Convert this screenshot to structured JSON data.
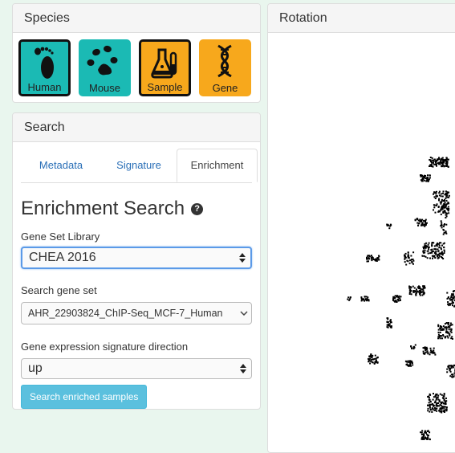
{
  "species_panel": {
    "title": "Species",
    "buttons": [
      {
        "label": "Human",
        "icon": "footprint-icon",
        "color": "#1bbab4",
        "selected": true
      },
      {
        "label": "Mouse",
        "icon": "paw-icon",
        "color": "#1bbab4",
        "selected": false
      },
      {
        "label": "Sample",
        "icon": "flask-icon",
        "color": "#f7a81c",
        "selected": true
      },
      {
        "label": "Gene",
        "icon": "dna-icon",
        "color": "#f7a81c",
        "selected": false
      }
    ]
  },
  "search_panel": {
    "title": "Search",
    "tabs": [
      {
        "label": "Metadata",
        "active": false
      },
      {
        "label": "Signature",
        "active": false
      },
      {
        "label": "Enrichment",
        "active": true
      }
    ],
    "form": {
      "heading": "Enrichment Search",
      "library_label": "Gene Set Library",
      "library_value": "CHEA 2016",
      "gene_set_label": "Search gene set",
      "gene_set_value": "AHR_22903824_ChIP-Seq_MCF-7_Human",
      "direction_label": "Gene expression signature direction",
      "direction_value": "up",
      "submit_label": "Search enriched samples"
    }
  },
  "rotation_panel": {
    "title": "Rotation"
  },
  "colors": {
    "teal": "#1bbab4",
    "orange": "#f7a81c",
    "link": "#2a6fb7",
    "button": "#5bc0de",
    "background": "#e9f6ee"
  }
}
